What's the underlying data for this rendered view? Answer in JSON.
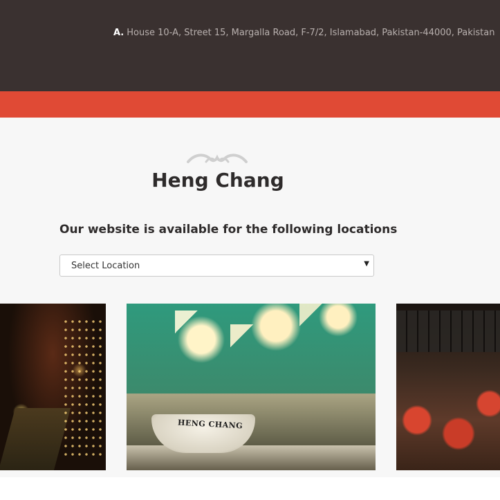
{
  "header": {
    "address_label": "A.",
    "address_text": "House 10-A, Street 15, Margalla Road, F-7/2, Islamabad, Pakistan-44000, Pakistan"
  },
  "brand": {
    "name": "Heng Chang"
  },
  "locations": {
    "heading": "Our website is available for the following locations",
    "select_value": "Select Location"
  },
  "gallery": {
    "cup_text": "HENG CHANG"
  },
  "colors": {
    "topbar": "#3a3130",
    "accent": "#e04a35",
    "content_bg": "#f7f7f7"
  }
}
